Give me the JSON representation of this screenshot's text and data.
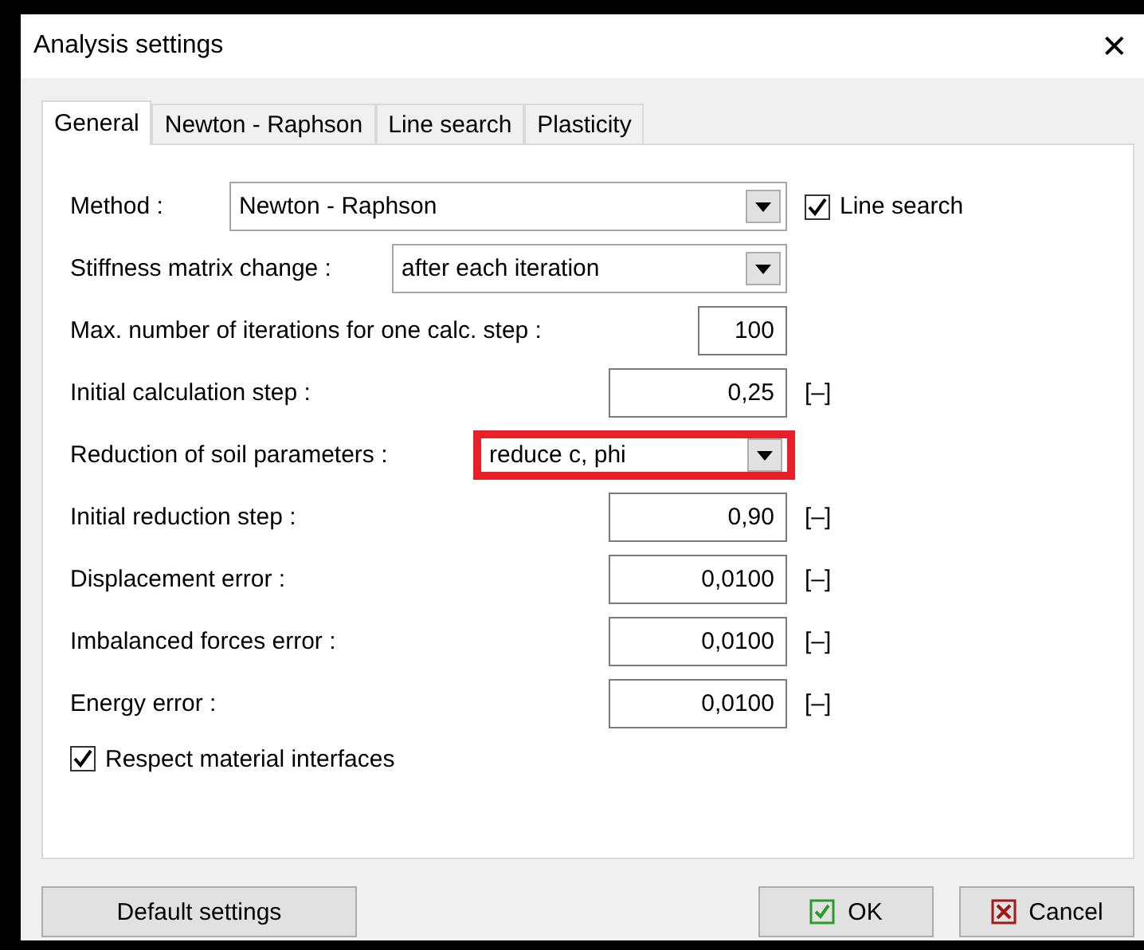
{
  "window": {
    "title": "Analysis settings",
    "close": "✕"
  },
  "tabs": [
    {
      "label": "General",
      "selected": true
    },
    {
      "label": "Newton - Raphson",
      "selected": false
    },
    {
      "label": "Line search",
      "selected": false
    },
    {
      "label": "Plasticity",
      "selected": false
    }
  ],
  "rows": [
    {
      "kind": "select",
      "label": "Method :",
      "value": "Newton - Raphson",
      "highlighted": false,
      "check": {
        "label": "Line search",
        "checked": true
      }
    },
    {
      "kind": "select",
      "label": "Stiffness matrix change :",
      "value": "after each iteration",
      "highlighted": false
    },
    {
      "kind": "number",
      "label": "Max. number of iterations for one calc. step :",
      "value": "100"
    },
    {
      "kind": "number",
      "label": "Initial calculation step :",
      "value": "0,25",
      "unit": "[–]"
    },
    {
      "kind": "select",
      "label": "Reduction of soil parameters :",
      "value": "reduce c, phi",
      "highlighted": true
    },
    {
      "kind": "number",
      "label": "Initial reduction step :",
      "value": "0,90",
      "unit": "[–]"
    },
    {
      "kind": "number",
      "label": "Displacement error :",
      "value": "0,0100",
      "unit": "[–]"
    },
    {
      "kind": "number",
      "label": "Imbalanced forces error :",
      "value": "0,0100",
      "unit": "[–]"
    },
    {
      "kind": "number",
      "label": "Energy error :",
      "value": "0,0100",
      "unit": "[–]"
    }
  ],
  "respect_interfaces": {
    "label": "Respect material interfaces",
    "checked": true
  },
  "buttons": {
    "default": "Default settings",
    "ok": "OK",
    "cancel": "Cancel"
  }
}
